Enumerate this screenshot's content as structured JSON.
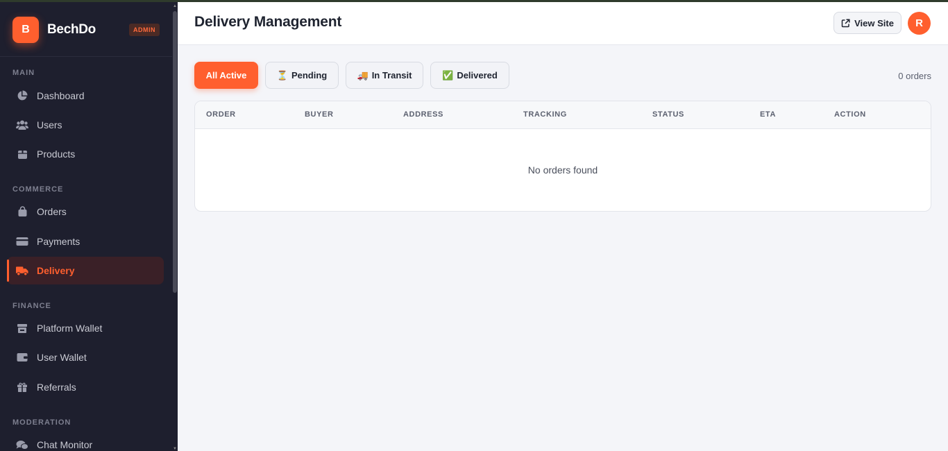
{
  "brand": {
    "logo_letter": "B",
    "name": "BechDo",
    "badge": "ADMIN"
  },
  "sidebar": {
    "sections": [
      {
        "label": "MAIN",
        "items": [
          {
            "label": "Dashboard",
            "icon": "pie-chart-icon"
          },
          {
            "label": "Users",
            "icon": "users-icon"
          },
          {
            "label": "Products",
            "icon": "box-icon"
          }
        ]
      },
      {
        "label": "COMMERCE",
        "items": [
          {
            "label": "Orders",
            "icon": "shopping-bag-icon"
          },
          {
            "label": "Payments",
            "icon": "credit-card-icon"
          },
          {
            "label": "Delivery",
            "icon": "truck-icon",
            "active": true
          }
        ]
      },
      {
        "label": "FINANCE",
        "items": [
          {
            "label": "Platform Wallet",
            "icon": "store-icon"
          },
          {
            "label": "User Wallet",
            "icon": "wallet-icon"
          },
          {
            "label": "Referrals",
            "icon": "gift-icon"
          }
        ]
      },
      {
        "label": "MODERATION",
        "items": [
          {
            "label": "Chat Monitor",
            "icon": "chat-icon"
          }
        ]
      }
    ]
  },
  "header": {
    "title": "Delivery Management",
    "view_site_label": "View Site",
    "avatar_letter": "R"
  },
  "filters": {
    "tabs": [
      {
        "label": "All Active",
        "emoji": "",
        "active": true
      },
      {
        "label": "Pending",
        "emoji": "⏳"
      },
      {
        "label": "In Transit",
        "emoji": "🚚"
      },
      {
        "label": "Delivered",
        "emoji": "✅"
      }
    ],
    "count_text": "0 orders"
  },
  "table": {
    "columns": [
      "ORDER",
      "BUYER",
      "ADDRESS",
      "TRACKING",
      "STATUS",
      "ETA",
      "ACTION"
    ],
    "empty_text": "No orders found"
  },
  "colors": {
    "accent": "#ff5f2e",
    "sidebar_bg": "#1e1f2e",
    "page_bg": "#f4f5f9"
  }
}
